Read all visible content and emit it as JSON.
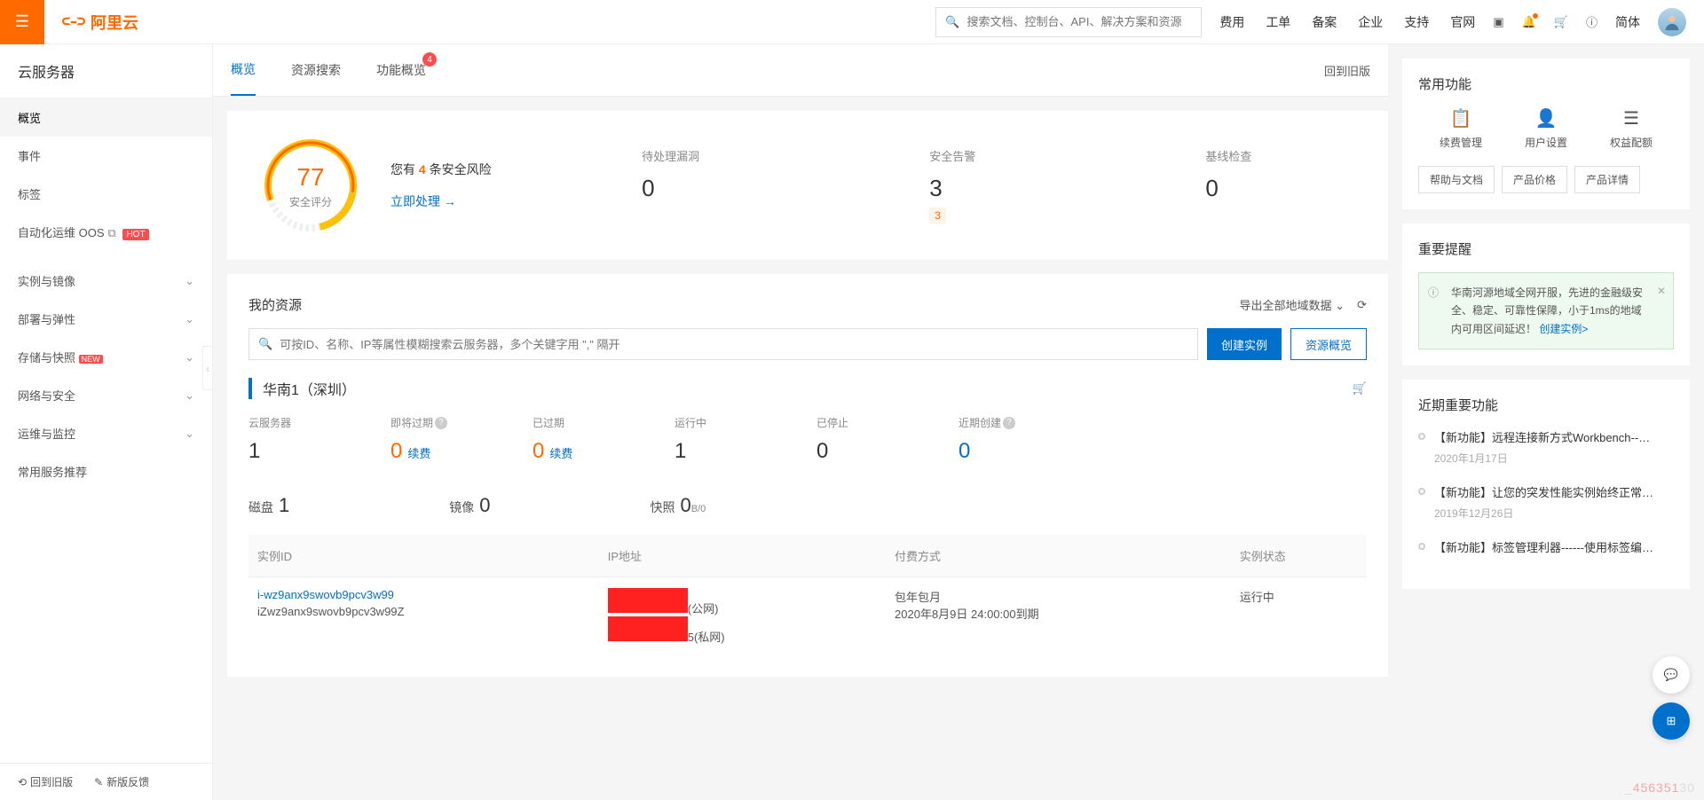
{
  "header": {
    "brand": "阿里云",
    "search_placeholder": "搜索文档、控制台、API、解决方案和资源",
    "nav": [
      "费用",
      "工单",
      "备案",
      "企业",
      "支持",
      "官网"
    ],
    "lang": "简体"
  },
  "sidebar": {
    "title": "云服务器",
    "items": [
      {
        "label": "概览",
        "active": true
      },
      {
        "label": "事件"
      },
      {
        "label": "标签"
      },
      {
        "label": "自动化运维 OOS",
        "ext": true,
        "hot": "HOT"
      }
    ],
    "groups": [
      {
        "label": "实例与镜像"
      },
      {
        "label": "部署与弹性"
      },
      {
        "label": "存储与快照",
        "new": "NEW"
      },
      {
        "label": "网络与安全"
      },
      {
        "label": "运维与监控"
      },
      {
        "label": "常用服务推荐",
        "no_chev": true
      }
    ],
    "footer": {
      "old": "回到旧版",
      "feedback": "新版反馈"
    }
  },
  "tabs": {
    "items": [
      {
        "label": "概览",
        "active": true
      },
      {
        "label": "资源搜索"
      },
      {
        "label": "功能概览",
        "badge": "4"
      }
    ],
    "back": "回到旧版"
  },
  "security": {
    "score": "77",
    "score_label": "安全评分",
    "risk_prefix": "您有 ",
    "risk_count": "4",
    "risk_suffix": " 条安全风险",
    "process": "立即处理 →",
    "stats": [
      {
        "label": "待处理漏洞",
        "value": "0"
      },
      {
        "label": "安全告警",
        "value": "3",
        "sub": "3"
      },
      {
        "label": "基线检查",
        "value": "0"
      }
    ]
  },
  "resources": {
    "title": "我的资源",
    "export": "导出全部地域数据",
    "search_placeholder": "可按ID、名称、IP等属性模糊搜索云服务器，多个关键字用 \",\" 隔开",
    "create_btn": "创建实例",
    "overview_btn": "资源概览",
    "region": "华南1（深圳）",
    "stats": [
      {
        "label": "云服务器",
        "value": "1"
      },
      {
        "label": "即将过期",
        "help": true,
        "value": "0",
        "warn": true,
        "link": "续费"
      },
      {
        "label": "已过期",
        "value": "0",
        "warn": true,
        "link": "续费"
      },
      {
        "label": "运行中",
        "value": "1"
      },
      {
        "label": "已停止",
        "value": "0"
      },
      {
        "label": "近期创建",
        "help": true,
        "value": "0",
        "blue": true
      }
    ],
    "mini": {
      "disk_label": "磁盘",
      "disk_value": "1",
      "image_label": "镜像",
      "image_value": "0",
      "snap_label": "快照",
      "snap_value": "0",
      "snap_sub": "B/0"
    },
    "table": {
      "cols": [
        "实例ID",
        "IP地址",
        "付费方式",
        "实例状态"
      ],
      "row": {
        "id": "i-wz9anx9swovb9pcv3w99",
        "name": "iZwz9anx9swovb9pcv3w99Z",
        "ip_pub_label": "(公网)",
        "ip_priv_label": "5(私网)",
        "pay_type": "包年包月",
        "pay_expire": "2020年8月9日 24:00:00到期",
        "status": "运行中"
      }
    }
  },
  "right": {
    "common_title": "常用功能",
    "actions": [
      {
        "label": "续费管理",
        "icon": "📋"
      },
      {
        "label": "用户设置",
        "icon": "👤"
      },
      {
        "label": "权益配额",
        "icon": "☰"
      }
    ],
    "pills": [
      "帮助与文档",
      "产品价格",
      "产品详情"
    ],
    "notice_title": "重要提醒",
    "alert": "华南河源地域全网开服，先进的金融级安全、稳定、可靠性保障，小于1ms的地域内可用区间延迟！",
    "alert_link": "创建实例>",
    "news_title": "近期重要功能",
    "news": [
      {
        "title": "【新功能】远程连接新方式Workbench--…",
        "date": "2020年1月17日"
      },
      {
        "title": "【新功能】让您的突发性能实例始终正常…",
        "date": "2019年12月26日"
      },
      {
        "title": "【新功能】标签管理利器------使用标签编…",
        "date": ""
      }
    ]
  },
  "watermark": {
    "pre": "_",
    "hl": "456351",
    "post": "30"
  }
}
